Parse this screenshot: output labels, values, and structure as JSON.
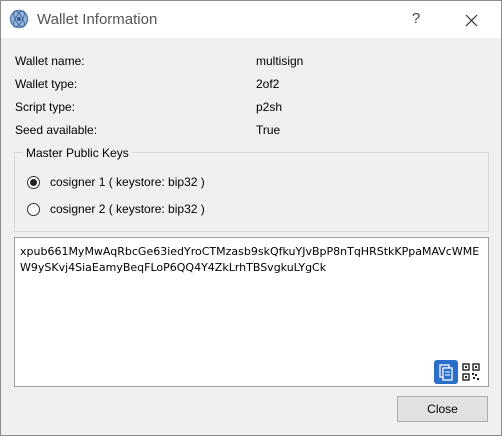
{
  "window": {
    "title": "Wallet Information",
    "help_label": "?"
  },
  "info": {
    "wallet_name_label": "Wallet name:",
    "wallet_name_value": "multisign",
    "wallet_type_label": "Wallet type:",
    "wallet_type_value": "2of2",
    "script_type_label": "Script type:",
    "script_type_value": "p2sh",
    "seed_label": "Seed available:",
    "seed_value": "True"
  },
  "keys_group": {
    "title": "Master Public Keys",
    "options": [
      {
        "label": "cosigner 1 ( keystore: bip32 )",
        "selected": true
      },
      {
        "label": "cosigner 2 ( keystore: bip32 )",
        "selected": false
      }
    ]
  },
  "key_box": {
    "value": "xpub661MyMwAqRbcGe63iedYroCTMzasb9skQfkuYJvBpP8nTqHRStkKPpaMAVcWMEW9ySKvj4SiaEamyBeqFLoP6QQ4Y4ZkLrhTBSvgkuLYgCk"
  },
  "footer": {
    "close_label": "Close"
  },
  "colors": {
    "accent": "#2b6fc8",
    "title_bg": "#ffffff",
    "dialog_bg": "#f0f0f0"
  },
  "icons": {
    "app": "electrum-icon",
    "close": "close-icon",
    "copy": "copy-icon",
    "qr": "qrcode-icon"
  }
}
